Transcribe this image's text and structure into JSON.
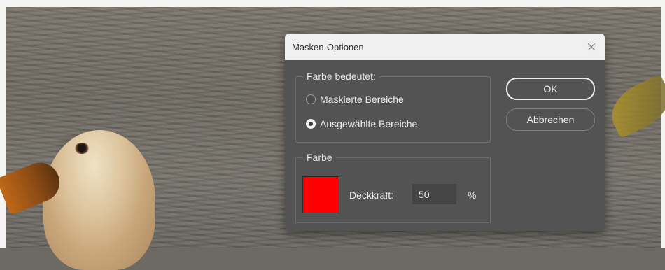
{
  "dialog": {
    "title": "Masken-Optionen",
    "color_meaning_group": {
      "legend": "Farbe bedeutet:",
      "options": [
        {
          "label": "Maskierte Bereiche",
          "selected": false
        },
        {
          "label": "Ausgewählte Bereiche",
          "selected": true
        }
      ]
    },
    "color_group": {
      "legend": "Farbe",
      "swatch_color": "#ff0000",
      "opacity_label": "Deckkraft:",
      "opacity_value": "50",
      "opacity_unit": "%"
    },
    "buttons": {
      "ok": "OK",
      "cancel": "Abbrechen"
    },
    "icons": {
      "close": "close-icon"
    }
  }
}
